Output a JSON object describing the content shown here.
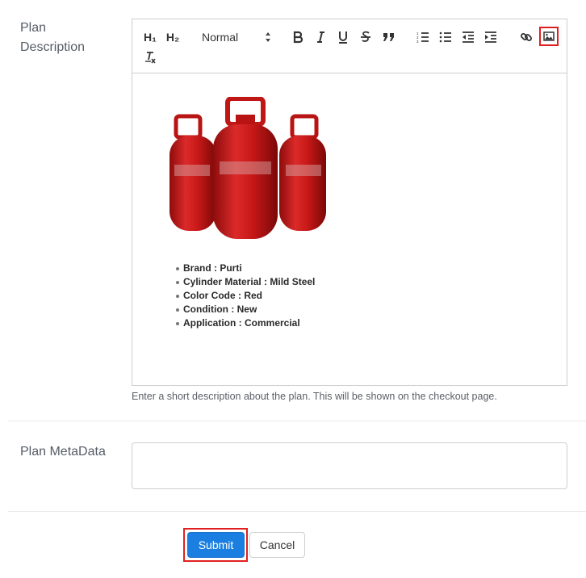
{
  "description": {
    "label_line1": "Plan",
    "label_line2": "Description",
    "toolbar": {
      "h1": "H₁",
      "h2": "H₂",
      "format_select": "Normal",
      "icons": [
        "bold-icon",
        "italic-icon",
        "underline-icon",
        "strikethrough-icon",
        "blockquote-icon",
        "ordered-list-icon",
        "bullet-list-icon",
        "outdent-icon",
        "indent-icon",
        "link-icon",
        "image-icon",
        "clear-format-icon"
      ]
    },
    "bullets": [
      "Brand : Purti",
      "Cylinder Material : Mild Steel",
      "Color Code : Red",
      "Condition : New",
      "Application : Commercial"
    ],
    "help_text": "Enter a short description about the plan. This will be shown on the checkout page."
  },
  "metadata": {
    "label": "Plan MetaData",
    "value": ""
  },
  "actions": {
    "submit": "Submit",
    "cancel": "Cancel"
  },
  "colors": {
    "primary": "#1a7fe0",
    "highlight": "#e02020",
    "cylinder_red": "#c81818"
  }
}
